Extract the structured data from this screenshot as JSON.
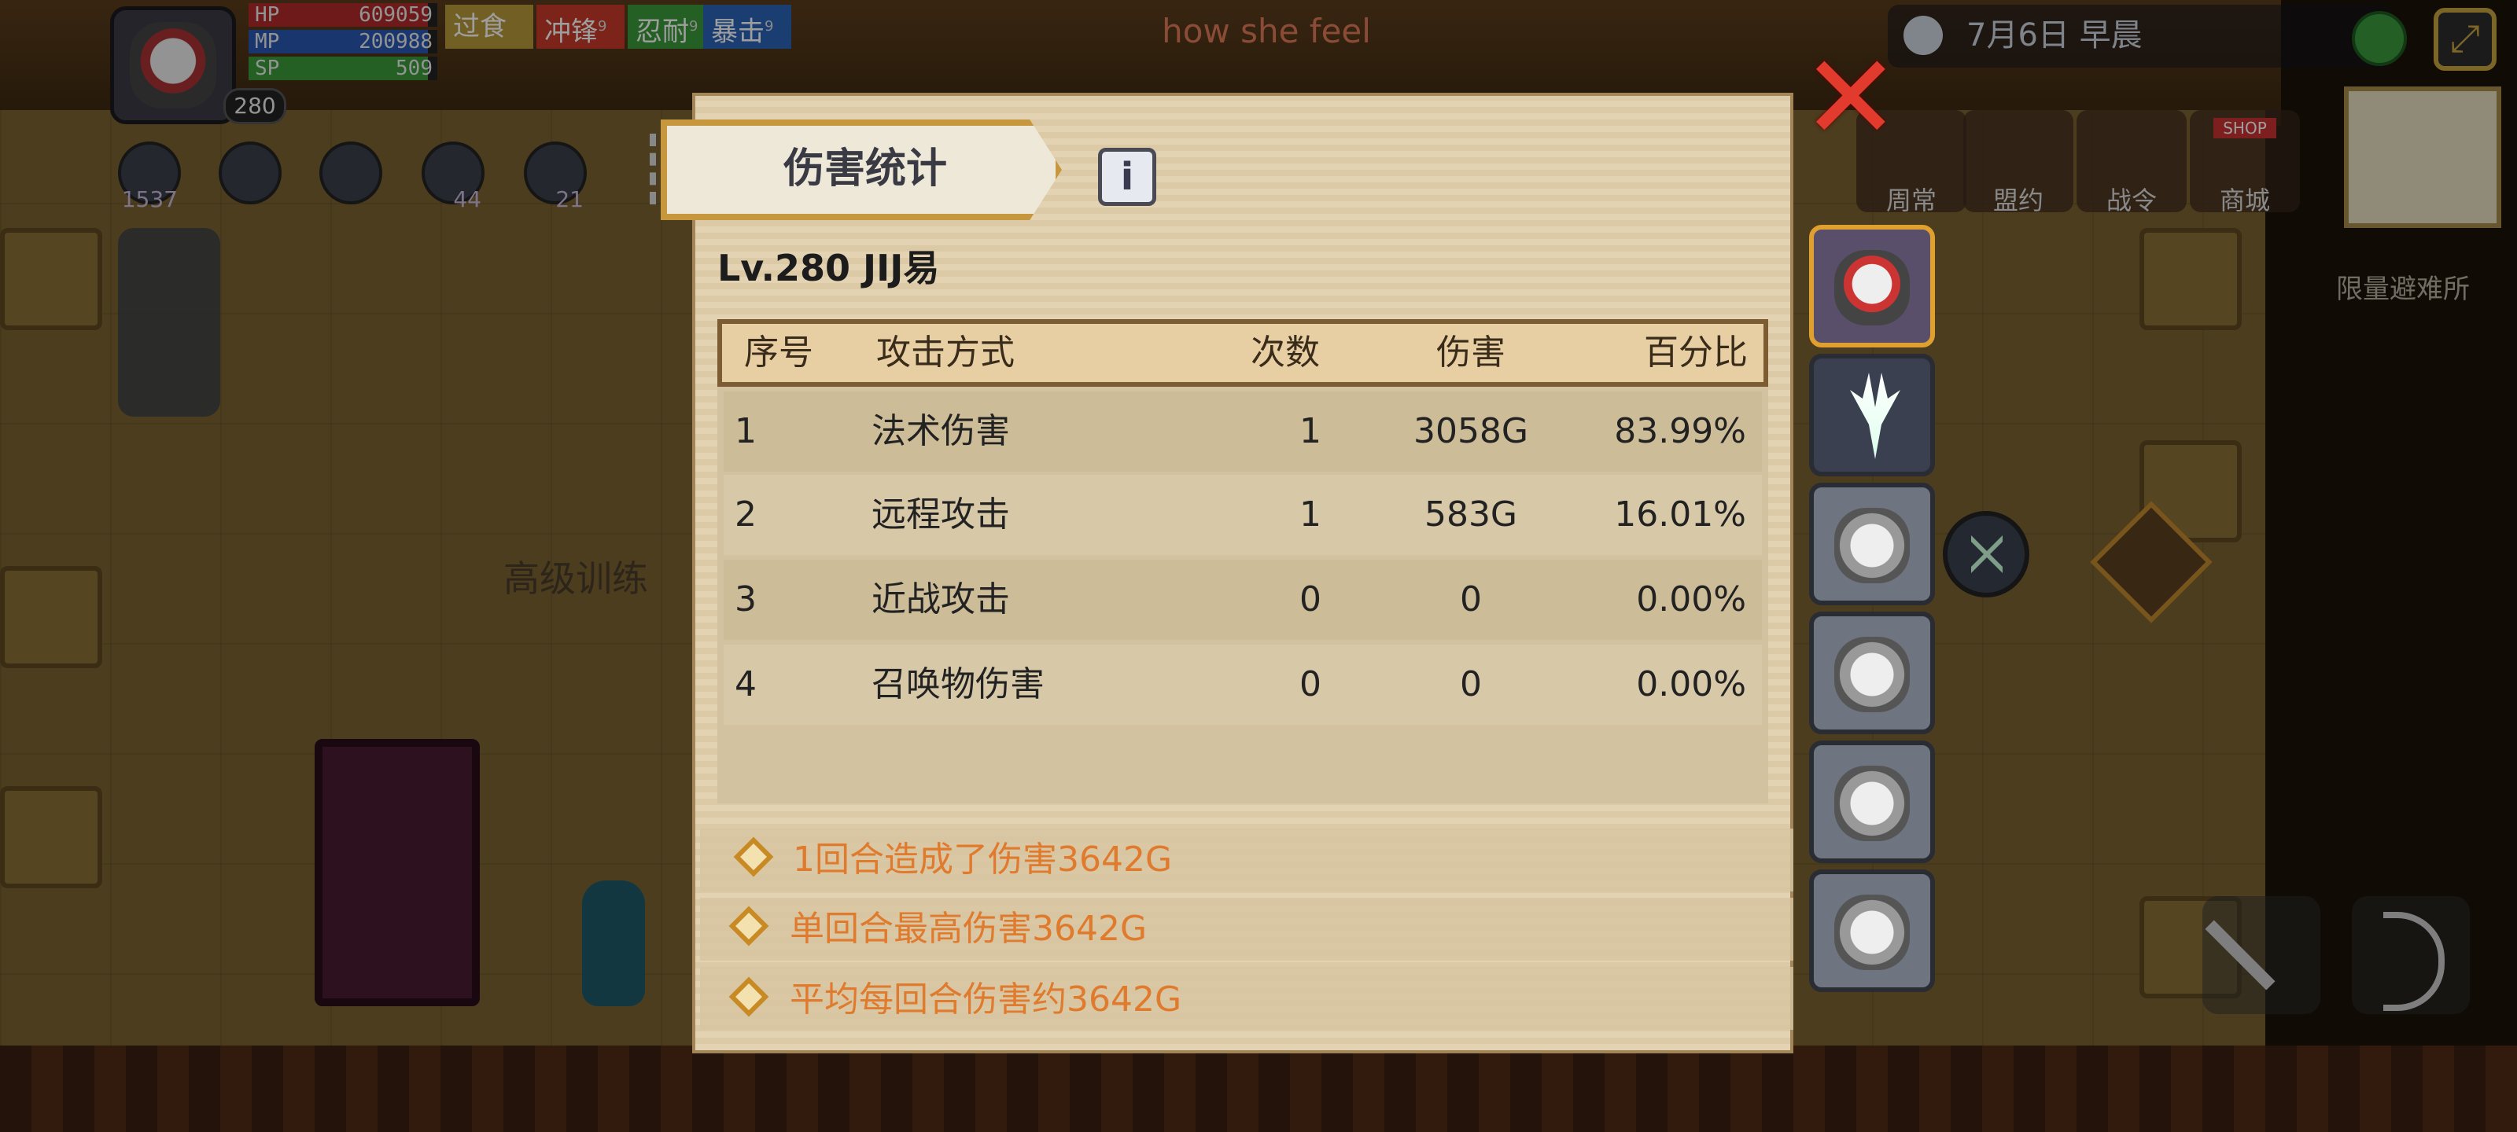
{
  "hud": {
    "level_badge": "280",
    "stats": [
      {
        "key": "HP",
        "value": "609059"
      },
      {
        "key": "MP",
        "value": "200988"
      },
      {
        "key": "SP",
        "value": "509"
      }
    ],
    "buffs": [
      {
        "label": "过食",
        "count": "",
        "color": "#b89a3a"
      },
      {
        "label": "冲锋",
        "count": "9",
        "color": "#c83a2a"
      },
      {
        "label": "忍耐",
        "count": "9",
        "color": "#3a9a3a"
      },
      {
        "label": "暴击",
        "count": "9",
        "color": "#2a64b8"
      }
    ],
    "skills": [
      {
        "icon": "swirl-icon",
        "count": "1537"
      },
      {
        "icon": "lightning-icon",
        "count": ""
      },
      {
        "icon": "bat-icon",
        "count": ""
      },
      {
        "icon": "hexagram-icon",
        "count": "44"
      },
      {
        "icon": "wing-icon",
        "count": "21"
      }
    ],
    "overlay_caption": "how she feel",
    "date_text": "7月6日  早晨",
    "menu": [
      {
        "label": "周常"
      },
      {
        "label": "盟约"
      },
      {
        "label": "战令"
      },
      {
        "label": "商城"
      }
    ],
    "shop_sign": "SHOP",
    "side_text": "限量避难所",
    "scene_label": "高级训练"
  },
  "dialog": {
    "title": "伤害统计",
    "info_symbol": "i",
    "player": "Lv.280  JIJ易",
    "close_symbol": "✕",
    "columns": [
      "序号",
      "攻击方式",
      "次数",
      "伤害",
      "百分比"
    ],
    "rows": [
      {
        "idx": "1",
        "type": "法术伤害",
        "count": "1",
        "damage": "3058G",
        "percent": "83.99%"
      },
      {
        "idx": "2",
        "type": "远程攻击",
        "count": "1",
        "damage": "583G",
        "percent": "16.01%"
      },
      {
        "idx": "3",
        "type": "近战攻击",
        "count": "0",
        "damage": "0",
        "percent": "0.00%"
      },
      {
        "idx": "4",
        "type": "召唤物伤害",
        "count": "0",
        "damage": "0",
        "percent": "0.00%"
      }
    ],
    "summary": [
      "1回合造成了伤害3642G",
      "单回合最高伤害3642G",
      "平均每回合伤害约3642G"
    ]
  },
  "portraits": [
    {
      "name": "hero-portrait",
      "selected": true
    },
    {
      "name": "antler-portrait",
      "selected": false
    },
    {
      "name": "maid-portrait",
      "selected": false
    },
    {
      "name": "maid-portrait",
      "selected": false
    },
    {
      "name": "maid-portrait",
      "selected": false
    },
    {
      "name": "maid-portrait",
      "selected": false
    }
  ],
  "colors": {
    "accent_orange": "#e07a2c",
    "close_red": "#e23b2e",
    "panel_bg": "#e4d3b2"
  }
}
